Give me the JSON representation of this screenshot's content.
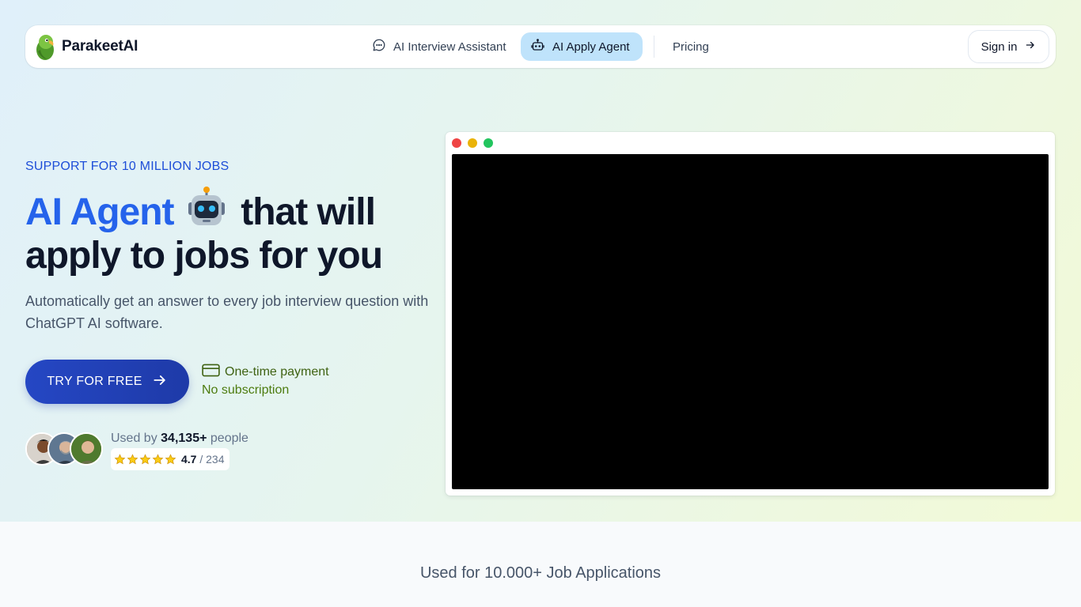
{
  "navbar": {
    "brand": "ParakeetAI",
    "items": [
      {
        "label": "AI Interview Assistant",
        "icon": "chat-bubble-icon"
      },
      {
        "label": "AI Apply Agent",
        "icon": "robot-icon",
        "active": true
      },
      {
        "label": "Pricing"
      }
    ],
    "signin_label": "Sign in"
  },
  "hero": {
    "eyebrow": "SUPPORT FOR 10 MILLION JOBS",
    "headline_accent": "AI Agent",
    "headline_emoji": "robot-face",
    "headline_rest_1": "that will",
    "headline_rest_2": "apply to jobs for you",
    "subtext": "Automatically get an answer to every job interview question with ChatGPT AI software.",
    "cta_label": "TRY FOR FREE",
    "payment_line1": "One-time payment",
    "payment_line2": "No subscription",
    "used_by_prefix": "Used by",
    "used_by_count": "34,135+",
    "used_by_suffix": "people",
    "rating": "4.7",
    "rating_count": "/ 234",
    "stars": 5
  },
  "video_window": {
    "controls": [
      "close",
      "minimize",
      "maximize"
    ]
  },
  "section": {
    "title": "Used for 10.000+ Job Applications"
  },
  "colors": {
    "accent": "#2563eb",
    "cta": "#1e3aa8",
    "active_nav": "#bfe3fb",
    "payment_green": "#4d7c0f",
    "star": "#facc15"
  }
}
